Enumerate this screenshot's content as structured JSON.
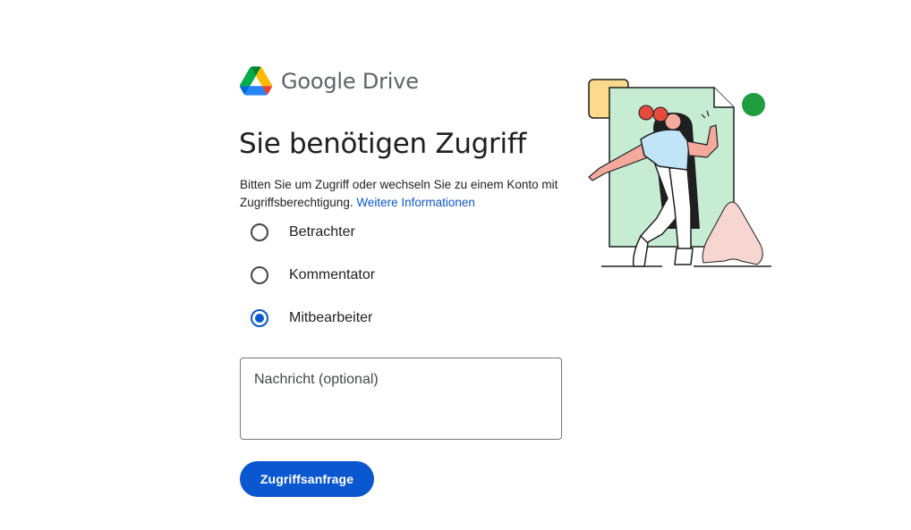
{
  "header": {
    "product_name": "Google Drive",
    "logo_icon": "google-drive-icon"
  },
  "main": {
    "title": "Sie benötigen Zugriff",
    "description_text": "Bitten Sie um Zugriff oder wechseln Sie zu einem Konto mit Zugriffsberechtigung. ",
    "learn_more_link": "Weitere Informationen",
    "roles": [
      {
        "label": "Betrachter",
        "selected": false
      },
      {
        "label": "Kommentator",
        "selected": false
      },
      {
        "label": "Mitbearbeiter",
        "selected": true
      }
    ],
    "message": {
      "placeholder": "Nachricht (optional)",
      "value": ""
    },
    "request_button_label": "Zugriffsanfrage"
  },
  "colors": {
    "accent": "#0b57d0",
    "text": "#1f1f1f",
    "illustration_green_doc": "#c6ecd4",
    "illustration_green_dot": "#1e9e3e",
    "illustration_yellow": "#fcd98d",
    "illustration_pink": "#f7d5d1",
    "illustration_red_hair": "#e54a3c",
    "illustration_shirt": "#c2e4f7"
  }
}
